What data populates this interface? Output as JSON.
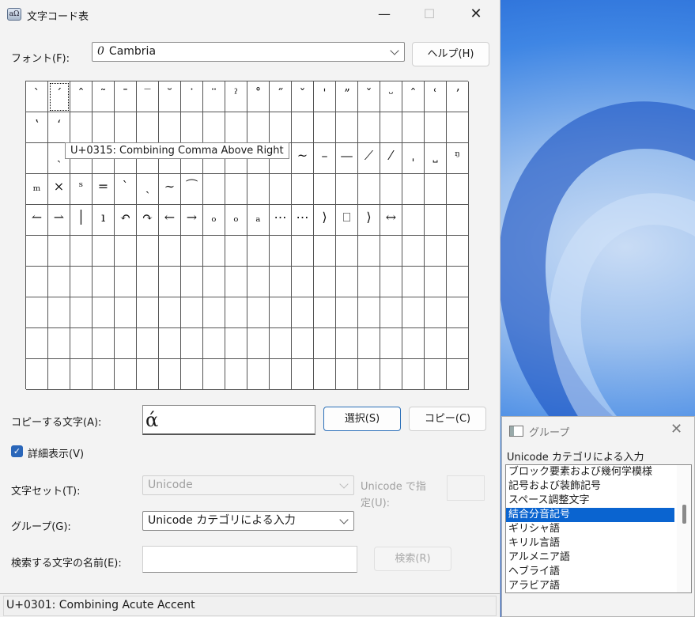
{
  "window": {
    "title": "文字コード表",
    "app_icon": "charmap-icon",
    "minimize": "—",
    "maximize": "☐",
    "close": "✕"
  },
  "font": {
    "label": "フォント(F):",
    "glyph": "0",
    "value": "Cambria",
    "help_button": "ヘルプ(H)"
  },
  "grid": {
    "rows": [
      [
        "ˋ",
        "ˊ",
        "ˆ",
        "˜",
        "ˉ",
        "‾",
        "˘",
        "˙",
        "¨",
        "ˀ",
        "˚",
        "˝",
        "ˇ",
        "ˈ",
        "ˮ",
        "ˇ",
        "ᵕ",
        "ˆ",
        "ʿ",
        "ʼ"
      ],
      [
        "ʽ",
        "ʻ",
        "",
        "",
        "",
        "",
        "",
        "",
        "",
        "",
        "",
        "",
        "",
        "",
        "",
        "",
        "",
        "",
        "",
        ""
      ],
      [
        "",
        "ˎ",
        "",
        "",
        "",
        "",
        "",
        "",
        "",
        "",
        "",
        "",
        "~",
        "–",
        "—",
        "⟋",
        "⁄",
        "ˌ",
        "˽",
        "ᵑ"
      ],
      [
        "ₘ",
        "×",
        "ˢ",
        "=",
        "ˋ",
        "ˏ",
        "∼",
        "⁀",
        "",
        "",
        "",
        "",
        "",
        "",
        "",
        "",
        "",
        "",
        "",
        ""
      ],
      [
        "↼",
        "⇀",
        "│",
        "ı",
        "↶",
        "↷",
        "←",
        "→",
        "ₒ",
        "ₒ",
        "ₐ",
        "⋯",
        "⋯",
        "⟩",
        "⎕",
        "⟩",
        "↔",
        "",
        "",
        ""
      ],
      [
        "",
        "",
        "",
        "",
        "",
        "",
        "",
        "",
        "",
        "",
        "",
        "",
        "",
        "",
        "",
        "",
        "",
        "",
        "",
        ""
      ],
      [
        "",
        "",
        "",
        "",
        "",
        "",
        "",
        "",
        "",
        "",
        "",
        "",
        "",
        "",
        "",
        "",
        "",
        "",
        "",
        ""
      ],
      [
        "",
        "",
        "",
        "",
        "",
        "",
        "",
        "",
        "",
        "",
        "",
        "",
        "",
        "",
        "",
        "",
        "",
        "",
        "",
        ""
      ],
      [
        "",
        "",
        "",
        "",
        "",
        "",
        "",
        "",
        "",
        "",
        "",
        "",
        "",
        "",
        "",
        "",
        "",
        "",
        "",
        ""
      ],
      [
        "",
        "",
        "",
        "",
        "",
        "",
        "",
        "",
        "",
        "",
        "",
        "",
        "",
        "",
        "",
        "",
        "",
        "",
        "",
        ""
      ]
    ],
    "tooltip": "U+0315: Combining Comma Above Right"
  },
  "copy": {
    "label": "コピーする文字(A):",
    "value": "ά",
    "select_button": "選択(S)",
    "copy_button": "コピー(C)"
  },
  "advanced": {
    "checkbox_label": "詳細表示(V)",
    "checked": true,
    "check_mark": "✓",
    "charset_label": "文字セット(T):",
    "charset_value": "Unicode",
    "unicode_goto_label_1": "Unicode で指",
    "unicode_goto_label_2": "定(U):",
    "group_label": "グループ(G):",
    "group_value": "Unicode カテゴリによる入力",
    "search_label": "検索する文字の名前(E):",
    "search_value": "",
    "search_button": "検索(R)"
  },
  "status": {
    "text": "U+0301: Combining Acute Accent"
  },
  "group_window": {
    "title": "グループ",
    "close": "✕",
    "caption": "Unicode カテゴリによる入力",
    "items": [
      "ブロック要素および幾何学模様",
      "記号および装飾記号",
      "スペース調整文字",
      "結合分音記号",
      "ギリシャ語",
      "キリル言語",
      "アルメニア語",
      "ヘブライ語",
      "アラビア語"
    ],
    "selected_index": 3
  },
  "colors": {
    "accent": "#0a64d0",
    "checkbox": "#2a66b9"
  }
}
